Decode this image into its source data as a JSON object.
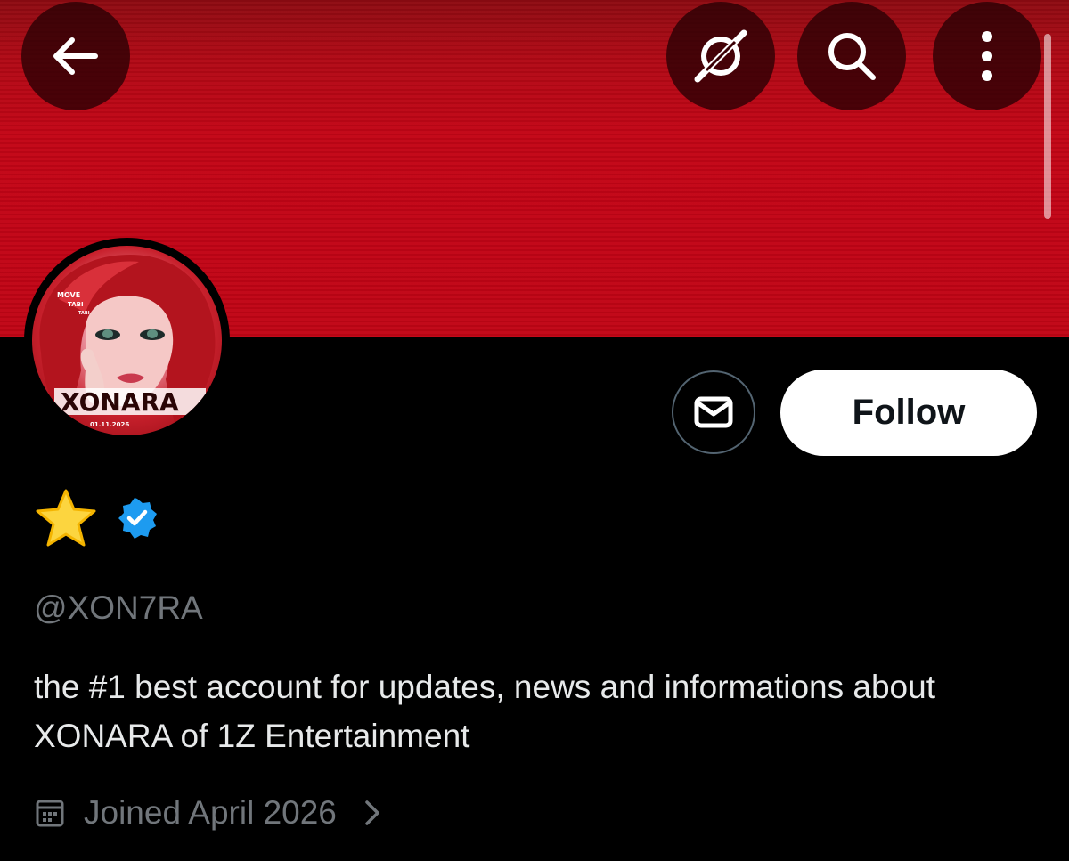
{
  "header": {
    "back_icon": "arrow-left-icon",
    "grok_icon": "grok-icon",
    "search_icon": "search-icon",
    "more_icon": "more-vertical-icon",
    "banner_color": "#c10515"
  },
  "profile": {
    "avatar": {
      "text_main": "XONARA",
      "text_top_1": "MOVE",
      "text_top_2": "TABI",
      "text_top_3": "TABI",
      "text_date": "01.11.2026"
    },
    "name_emoji": "star-emoji-icon",
    "verified_icon": "verified-badge-icon",
    "verified_color": "#1d9bf0",
    "handle": "@XON7RA",
    "bio": "the #1 best account for updates, news and informations about XONARA of 1Z Entertainment",
    "joined": "Joined April 2026"
  },
  "actions": {
    "message_icon": "envelope-icon",
    "follow_label": "Follow"
  }
}
